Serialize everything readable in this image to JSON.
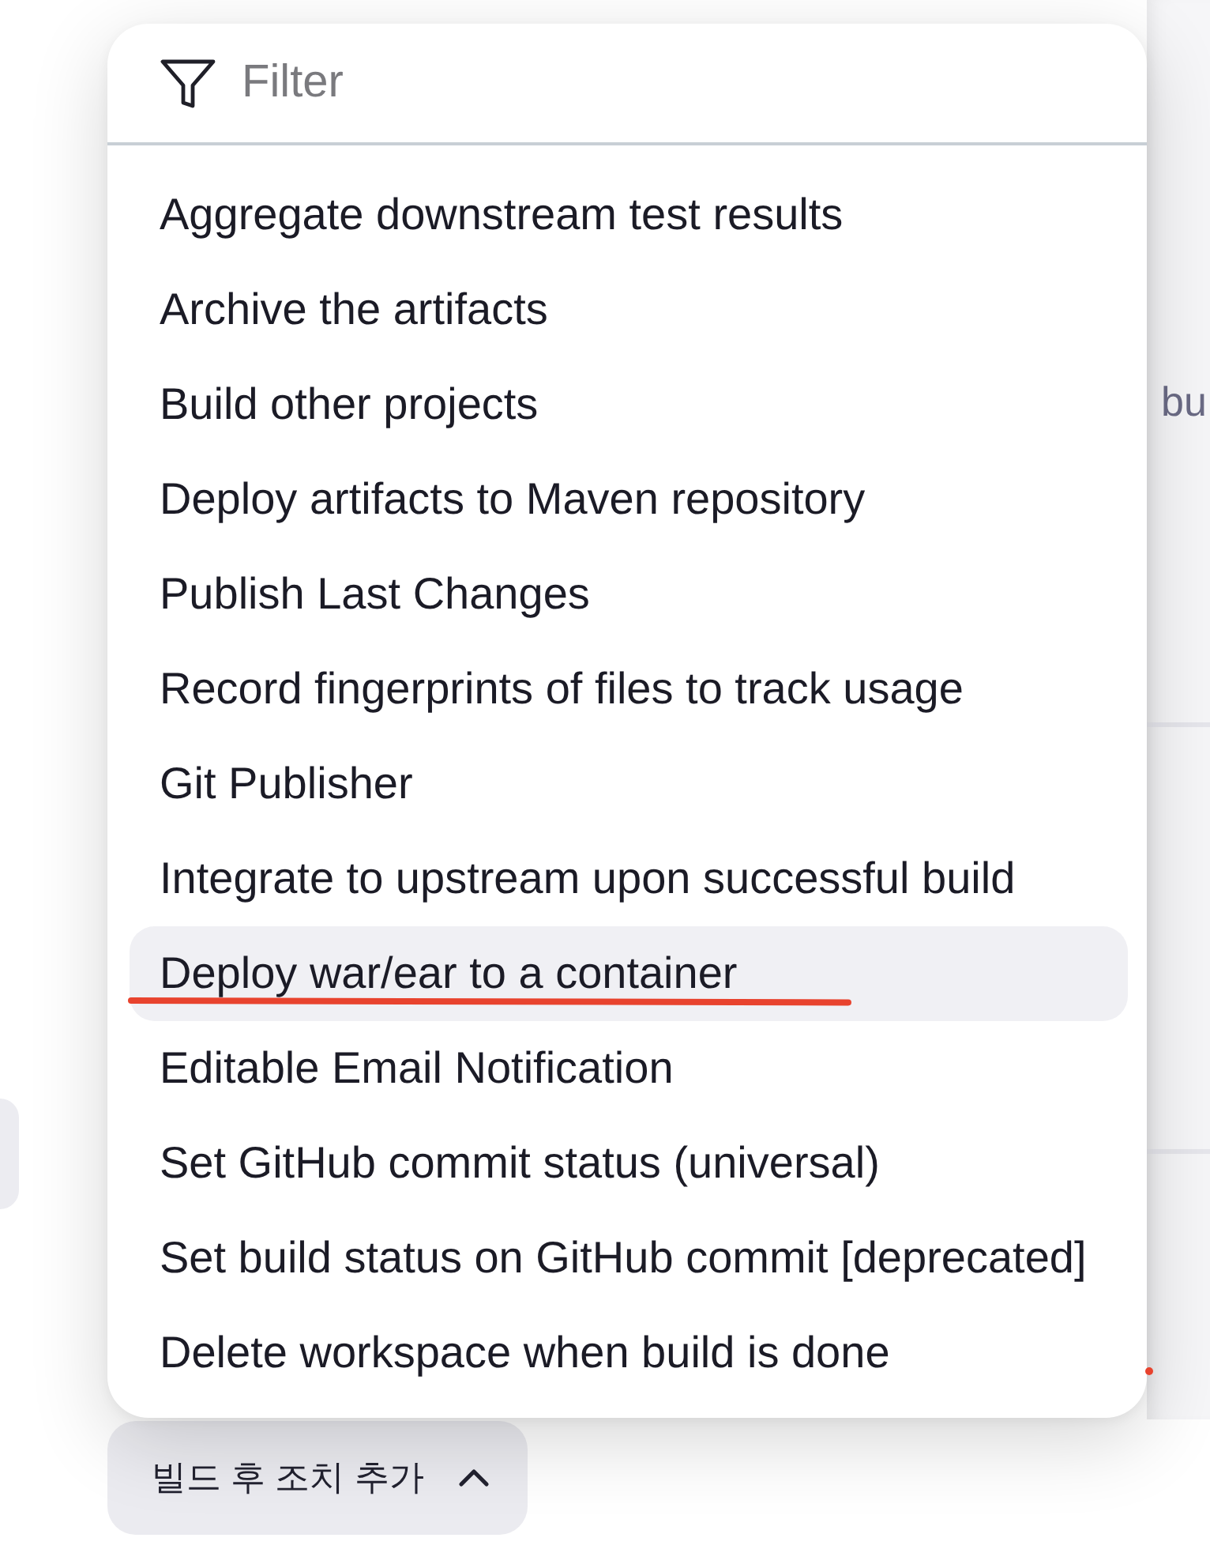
{
  "filter": {
    "placeholder": "Filter"
  },
  "items": [
    {
      "label": "Aggregate downstream test results",
      "selected": false,
      "underlined": false
    },
    {
      "label": "Archive the artifacts",
      "selected": false,
      "underlined": false
    },
    {
      "label": "Build other projects",
      "selected": false,
      "underlined": false
    },
    {
      "label": "Deploy artifacts to Maven repository",
      "selected": false,
      "underlined": false
    },
    {
      "label": "Publish Last Changes",
      "selected": false,
      "underlined": false
    },
    {
      "label": "Record fingerprints of files to track usage",
      "selected": false,
      "underlined": false
    },
    {
      "label": "Git Publisher",
      "selected": false,
      "underlined": false
    },
    {
      "label": "Integrate to upstream upon successful build",
      "selected": false,
      "underlined": false
    },
    {
      "label": "Deploy war/ear to a container",
      "selected": true,
      "underlined": true
    },
    {
      "label": "Editable Email Notification",
      "selected": false,
      "underlined": false
    },
    {
      "label": "Set GitHub commit status (universal)",
      "selected": false,
      "underlined": false
    },
    {
      "label": "Set build status on GitHub commit [deprecated]",
      "selected": false,
      "underlined": false
    },
    {
      "label": "Delete workspace when build is done",
      "selected": false,
      "underlined": false
    }
  ],
  "page_behind": {
    "side_text": "bu"
  },
  "add_button": {
    "label": "빌드 후 조치 추가",
    "expanded": true
  }
}
